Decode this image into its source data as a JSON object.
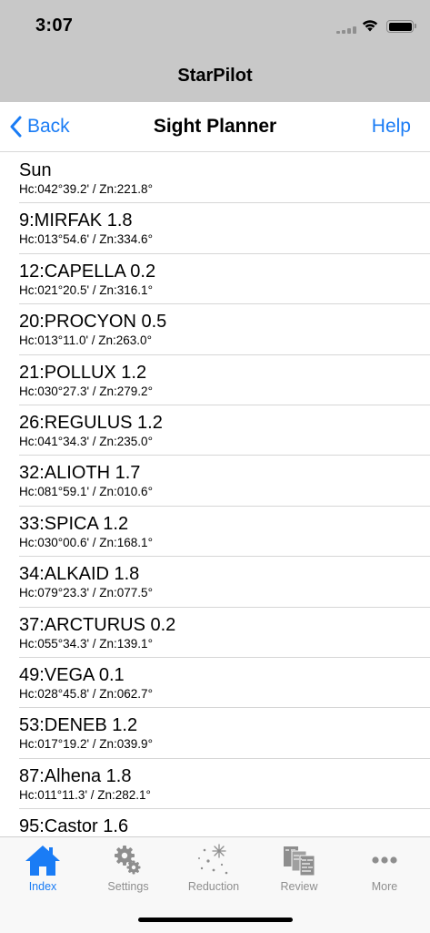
{
  "status_bar": {
    "time": "3:07"
  },
  "app": {
    "title": "StarPilot"
  },
  "nav": {
    "back_label": "Back",
    "title": "Sight Planner",
    "help_label": "Help"
  },
  "list": [
    {
      "title": "Sun",
      "sub": "Hc:042°39.2' / Zn:221.8°"
    },
    {
      "title": "9:MIRFAK 1.8",
      "sub": "Hc:013°54.6' / Zn:334.6°"
    },
    {
      "title": "12:CAPELLA 0.2",
      "sub": "Hc:021°20.5' / Zn:316.1°"
    },
    {
      "title": "20:PROCYON 0.5",
      "sub": "Hc:013°11.0' / Zn:263.0°"
    },
    {
      "title": "21:POLLUX 1.2",
      "sub": "Hc:030°27.3' / Zn:279.2°"
    },
    {
      "title": "26:REGULUS 1.2",
      "sub": "Hc:041°34.3' / Zn:235.0°"
    },
    {
      "title": "32:ALIOTH 1.7",
      "sub": "Hc:081°59.1' / Zn:010.6°"
    },
    {
      "title": "33:SPICA 1.2",
      "sub": "Hc:030°00.6' / Zn:168.1°"
    },
    {
      "title": "34:ALKAID 1.8",
      "sub": "Hc:079°23.3' / Zn:077.5°"
    },
    {
      "title": "37:ARCTURUS 0.2",
      "sub": "Hc:055°34.3' / Zn:139.1°"
    },
    {
      "title": "49:VEGA 0.1",
      "sub": "Hc:028°45.8' / Zn:062.7°"
    },
    {
      "title": "53:DENEB 1.2",
      "sub": "Hc:017°19.2' / Zn:039.9°"
    },
    {
      "title": "87:Alhena 1.8",
      "sub": "Hc:011°11.3' / Zn:282.1°"
    },
    {
      "title": "95:Castor 1.6",
      "sub": ""
    }
  ],
  "tabs": [
    {
      "label": "Index",
      "icon": "home-icon",
      "active": true
    },
    {
      "label": "Settings",
      "icon": "gears-icon",
      "active": false
    },
    {
      "label": "Reduction",
      "icon": "sparkle-icon",
      "active": false
    },
    {
      "label": "Review",
      "icon": "review-icon",
      "active": false
    },
    {
      "label": "More",
      "icon": "more-icon",
      "active": false
    }
  ],
  "colors": {
    "accent": "#1a7cf5",
    "inactive_tab": "#8e8e8e",
    "header_bg": "#c8c8c8"
  }
}
